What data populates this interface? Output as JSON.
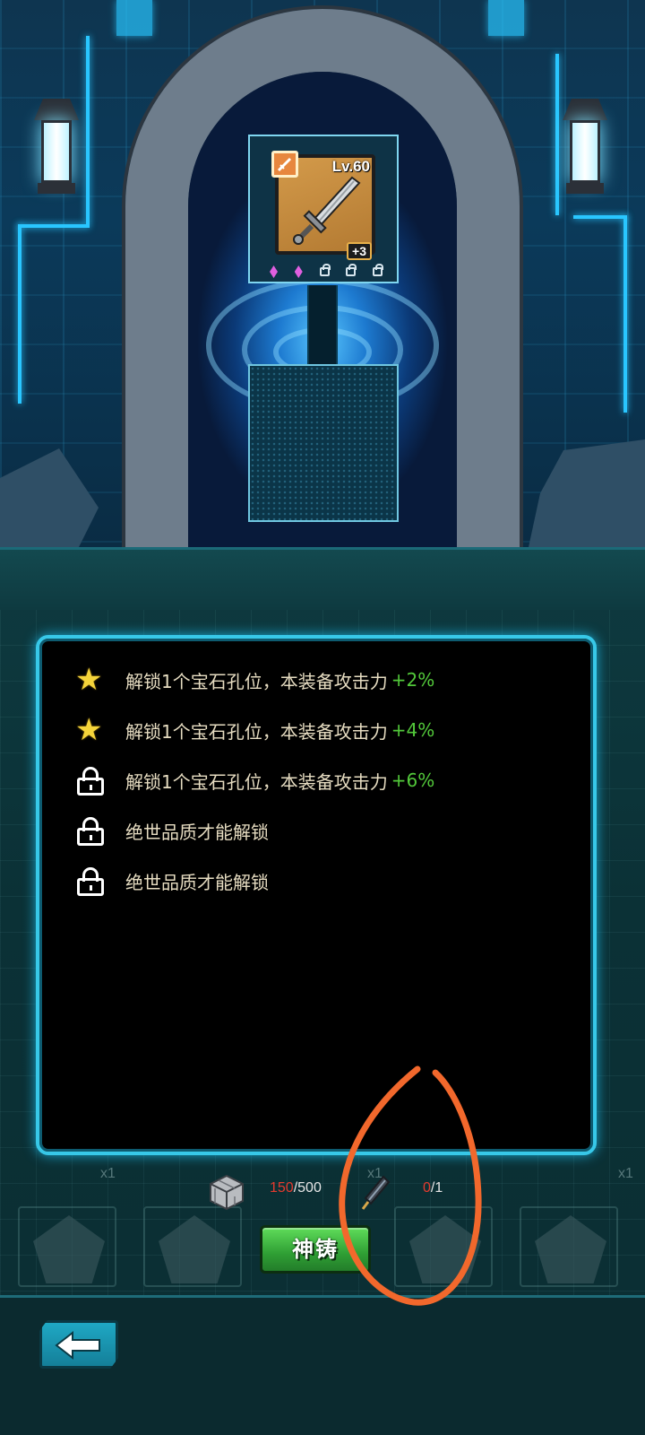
{
  "equipment": {
    "level": "Lv.60",
    "enhance": "+3",
    "icon": "sword-icon",
    "class_icon": "sword-class-icon",
    "sockets": [
      "gem",
      "gem",
      "locked",
      "locked",
      "locked"
    ]
  },
  "effects": [
    {
      "icon": "star-icon",
      "text": "解锁1个宝石孔位，本装备攻击力",
      "bonus": "+2%"
    },
    {
      "icon": "star-icon",
      "text": "解锁1个宝石孔位，本装备攻击力",
      "bonus": "+4%"
    },
    {
      "icon": "lock-icon",
      "text": "解锁1个宝石孔位，本装备攻击力",
      "bonus": "+6%"
    },
    {
      "icon": "lock-icon",
      "text": "绝世品质才能解锁",
      "bonus": ""
    },
    {
      "icon": "lock-icon",
      "text": "绝世品质才能解锁",
      "bonus": ""
    }
  ],
  "costs": [
    {
      "icon": "cube-material-icon",
      "have": "150",
      "need": "/500"
    },
    {
      "icon": "rod-material-icon",
      "have": "0",
      "need": "/1"
    }
  ],
  "forge_button": {
    "label": "神铸"
  },
  "background_counts": [
    "x1",
    "x1",
    "x1"
  ],
  "colors": {
    "panel_border": "#37c8e8",
    "bonus_green": "#52c83a",
    "cost_red": "#e53a2e",
    "button_green": "#3db83f",
    "annotation_orange": "#f2682c"
  }
}
